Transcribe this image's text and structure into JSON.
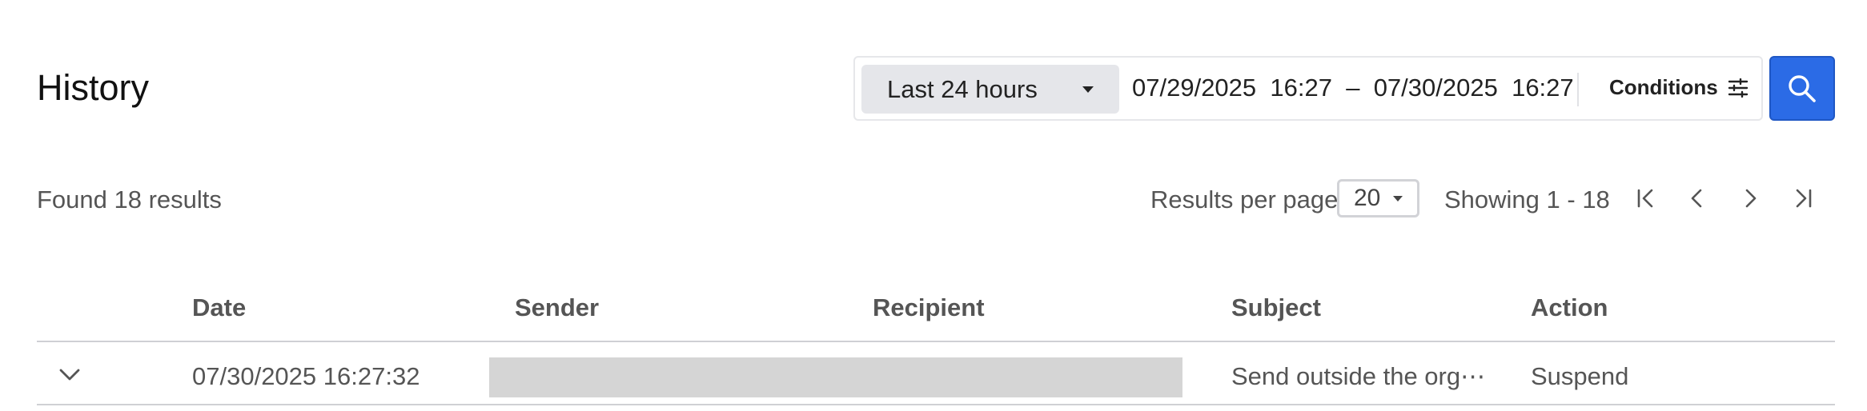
{
  "header": {
    "title": "History"
  },
  "filter": {
    "range_label": "Last 24 hours",
    "start_date": "07/29/2025",
    "start_time": "16:27",
    "dash": "–",
    "end_date": "07/30/2025",
    "end_time": "16:27",
    "conditions_label": "Conditions"
  },
  "results": {
    "found_text": "Found 18 results",
    "per_page_label": "Results per page",
    "per_page_value": "20",
    "showing_text": "Showing 1 - 18"
  },
  "table": {
    "columns": [
      "Date",
      "Sender",
      "Recipient",
      "Subject",
      "Action"
    ],
    "rows": [
      {
        "date": "07/30/2025 16:27:32",
        "subject": "Send outside the org⋯",
        "action": "Suspend"
      }
    ]
  },
  "colors": {
    "accent": "#2b6be6",
    "redaction": "#d5d5d5"
  },
  "icons": [
    "caret-down-icon",
    "conditions-sliders-icon",
    "search-icon",
    "first-page-icon",
    "prev-page-icon",
    "next-page-icon",
    "last-page-icon",
    "chevron-down-icon"
  ]
}
